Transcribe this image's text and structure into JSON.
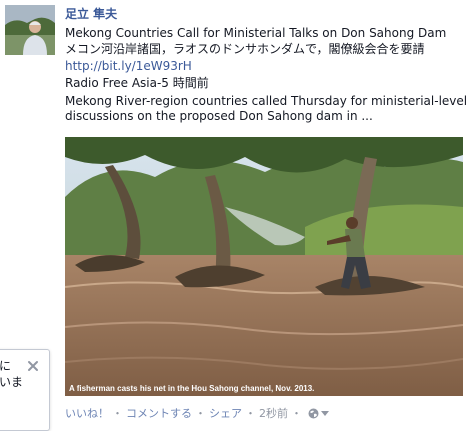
{
  "post": {
    "author": "足立 隼夫",
    "text_lines": [
      "Mekong Countries Call for Ministerial Talks on Don Sahong Dam",
      "メコン河沿岸諸国，ラオスのドンサホンダムで，閣僚級会合を要請"
    ],
    "link_url": "http://bit.ly/1eW93rH",
    "source_line": "Radio Free Asia-5 時間前",
    "summary_lines": [
      "Mekong River-region countries called Thursday for ministerial-level",
      "discussions on the proposed Don Sahong dam in ..."
    ],
    "photo_caption": "A fisherman casts his net in the Hou Sahong channel, Nov. 2013."
  },
  "actions": {
    "like": "いいね！",
    "comment": "コメントする",
    "share": "シェア",
    "timestamp": "2秒前",
    "separator": "・",
    "privacy_icon": "globe-icon"
  },
  "popup": {
    "text_lines": [
      "に",
      "いま"
    ],
    "close_icon": "close-icon"
  },
  "colors": {
    "link": "#3b5998",
    "action_link": "#6d84b4",
    "muted": "#9197a3",
    "text": "#141823"
  }
}
